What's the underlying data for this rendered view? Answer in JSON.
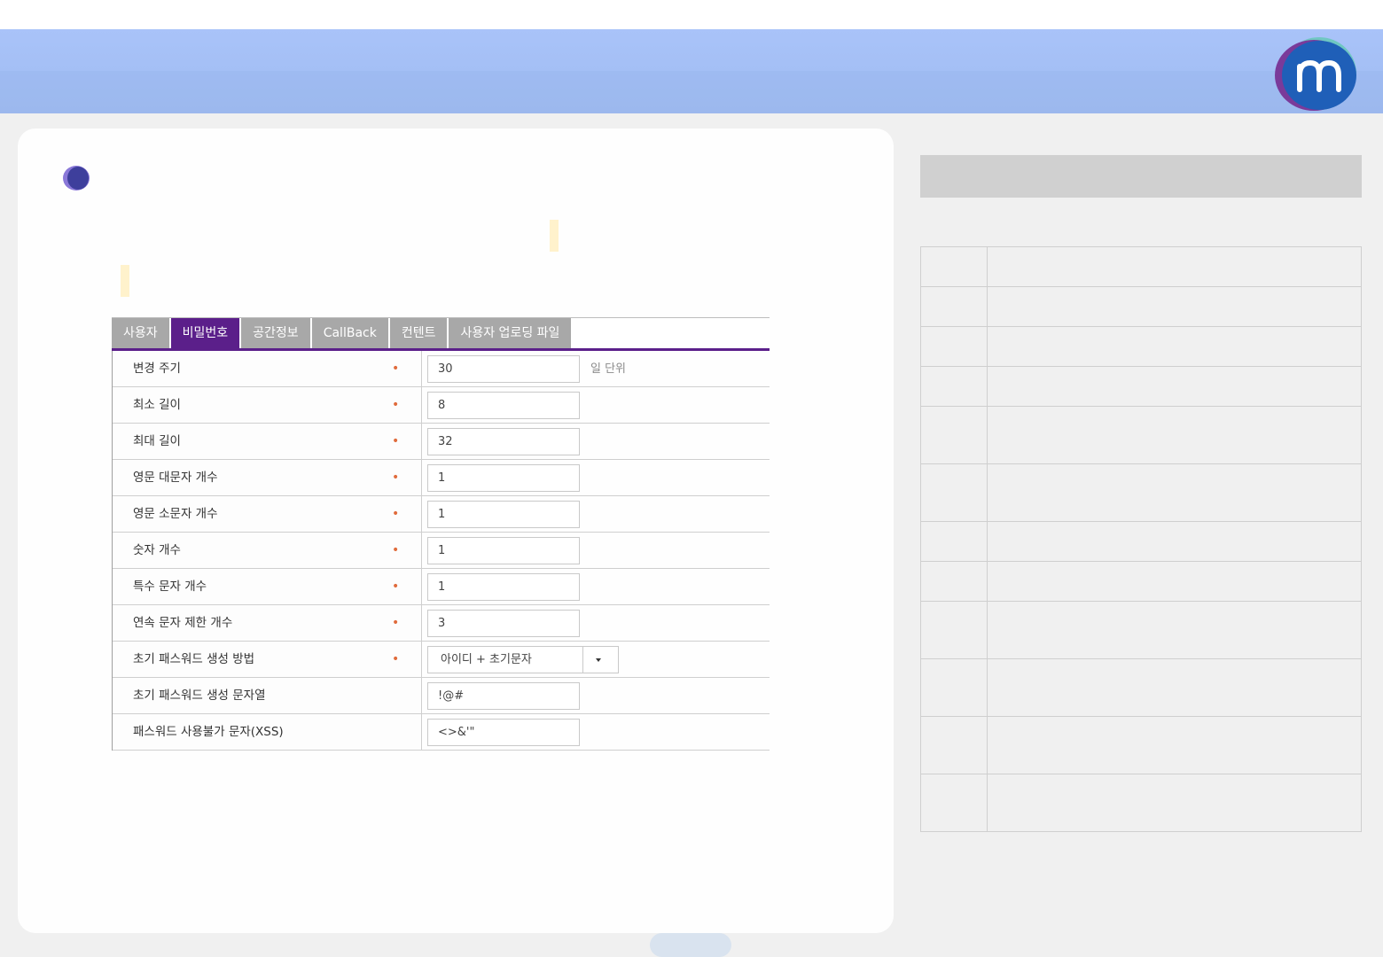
{
  "header": {
    "logo_icon": "m-logo-icon"
  },
  "colors": {
    "accent": "#5b1f8a",
    "header": "#a6c0f7",
    "required": "#e06b3c",
    "tab_inactive": "#a8a8a8"
  },
  "tabs": [
    {
      "label": "사용자",
      "active": false
    },
    {
      "label": "비밀번호",
      "active": true
    },
    {
      "label": "공간정보",
      "active": false
    },
    {
      "label": "CallBack",
      "active": false
    },
    {
      "label": "컨텐트",
      "active": false
    },
    {
      "label": "사용자 업로딩 파일",
      "active": false
    }
  ],
  "rows": [
    {
      "label": "변경 주기",
      "required": "•",
      "value": "30",
      "unit": "일 단위"
    },
    {
      "label": "최소 길이",
      "required": "•",
      "value": "8"
    },
    {
      "label": "최대 길이",
      "required": "•",
      "value": "32"
    },
    {
      "label": "영문 대문자 개수",
      "required": "•",
      "value": "1"
    },
    {
      "label": "영문 소문자 개수",
      "required": "•",
      "value": "1"
    },
    {
      "label": "숫자 개수",
      "required": "•",
      "value": "1"
    },
    {
      "label": "특수 문자 개수",
      "required": "•",
      "value": "1"
    },
    {
      "label": "연속 문자 제한 개수",
      "required": "•",
      "value": "3"
    },
    {
      "label": "초기 패스워드 생성 방법",
      "required": "•",
      "select": "아이디 + 초기문자"
    },
    {
      "label": "초기 패스워드 생성 문자열",
      "value": "!@#"
    },
    {
      "label": "패스워드 사용불가 문자(XSS)",
      "value": "<>&'\""
    }
  ]
}
